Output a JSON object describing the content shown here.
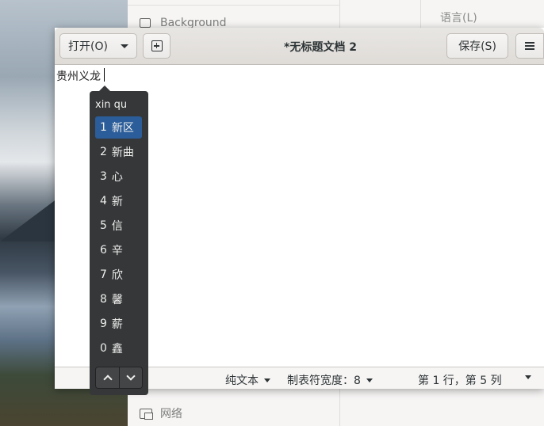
{
  "settings_bg": {
    "items": [
      {
        "label": "Background",
        "icon": "background-icon"
      },
      {
        "label": "网络",
        "icon": "network-icon"
      }
    ],
    "language_label": "语言(L)"
  },
  "gedit": {
    "open_label": "打开(O)",
    "new_tab_icon": "new-tab-icon",
    "title": "*无标题文档 2",
    "save_label": "保存(S)",
    "menu_icon": "hamburger-menu-icon",
    "editor_text": "贵州义龙",
    "status": {
      "syntax": "纯文本",
      "tab_width": "制表符宽度：8",
      "position": "第 1 行，第 5 列"
    }
  },
  "ime": {
    "pinyin": "xin qu",
    "candidates": [
      {
        "num": "1",
        "text": "新区"
      },
      {
        "num": "2",
        "text": "新曲"
      },
      {
        "num": "3",
        "text": "心"
      },
      {
        "num": "4",
        "text": "新"
      },
      {
        "num": "5",
        "text": "信"
      },
      {
        "num": "6",
        "text": "辛"
      },
      {
        "num": "7",
        "text": "欣"
      },
      {
        "num": "8",
        "text": "馨"
      },
      {
        "num": "9",
        "text": "薪"
      },
      {
        "num": "0",
        "text": "鑫"
      }
    ],
    "selected_index": 0
  },
  "colors": {
    "selection": "#2a5d9a",
    "popup_bg": "#353739"
  }
}
